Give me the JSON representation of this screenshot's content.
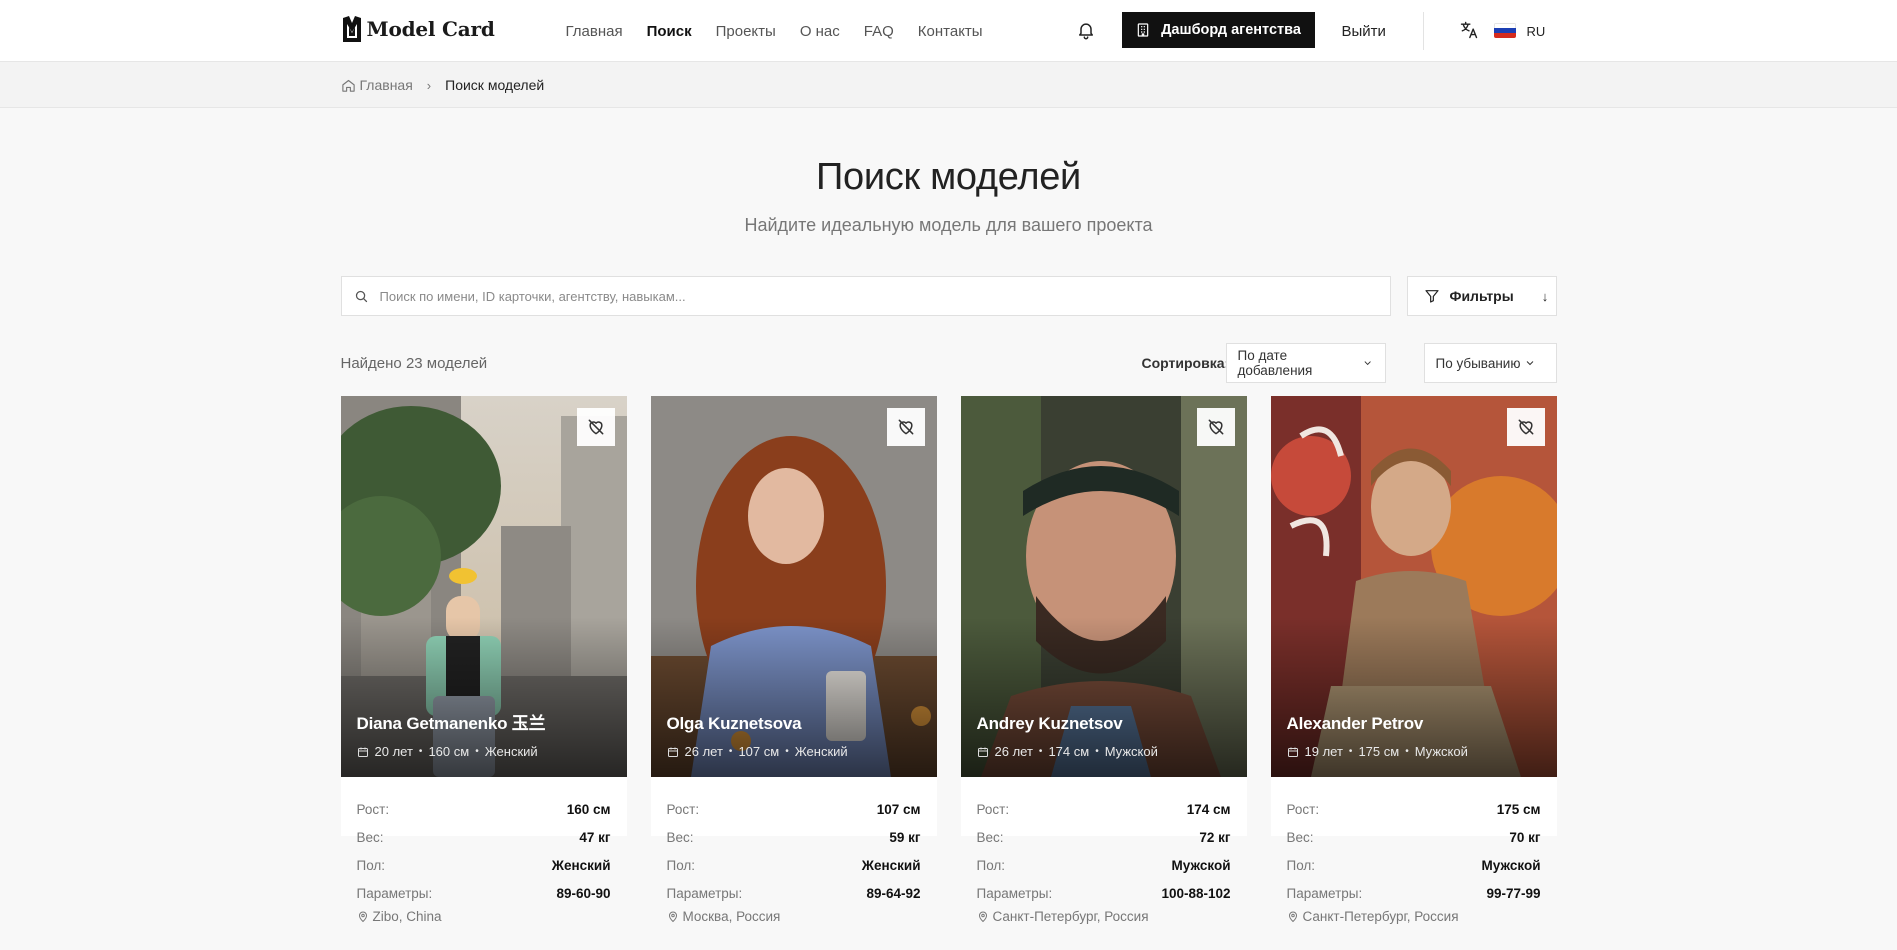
{
  "header": {
    "logo_text": "Model Card",
    "nav": [
      {
        "label": "Главная",
        "active": false
      },
      {
        "label": "Поиск",
        "active": true
      },
      {
        "label": "Проекты",
        "active": false
      },
      {
        "label": "О нас",
        "active": false
      },
      {
        "label": "FAQ",
        "active": false
      },
      {
        "label": "Контакты",
        "active": false
      }
    ],
    "dashboard_label": "Дашборд агентства",
    "logout_label": "Выйти",
    "language": "RU"
  },
  "breadcrumb": {
    "home": "Главная",
    "current": "Поиск моделей"
  },
  "hero": {
    "title": "Поиск моделей",
    "subtitle": "Найдите идеальную модель для вашего проекта"
  },
  "search": {
    "placeholder": "Поиск по имени, ID карточки, агентству, навыкам...",
    "value": "",
    "filters_label": "Фильтры",
    "filters_arrow": "↓"
  },
  "results": {
    "found": "Найдено 23 моделей",
    "sort_label": "Сортировка:",
    "sort_by": "По дате добавления",
    "sort_order": "По убыванию"
  },
  "labels": {
    "height": "Рост:",
    "weight": "Вес:",
    "gender": "Пол:",
    "params": "Параметры:"
  },
  "cards": [
    {
      "name": "Diana Getmanenko 玉兰",
      "age": "20 лет",
      "height_short": "160 см",
      "gender_short": "Женский",
      "height": "160 см",
      "weight": "47 кг",
      "gender": "Женский",
      "params": "89-60-90",
      "location": "Zibo, China"
    },
    {
      "name": "Olga Kuznetsova",
      "age": "26 лет",
      "height_short": "107 см",
      "gender_short": "Женский",
      "height": "107 см",
      "weight": "59 кг",
      "gender": "Женский",
      "params": "89-64-92",
      "location": "Москва, Россия"
    },
    {
      "name": "Andrey Kuznetsov",
      "age": "26 лет",
      "height_short": "174 см",
      "gender_short": "Мужской",
      "height": "174 см",
      "weight": "72 кг",
      "gender": "Мужской",
      "params": "100-88-102",
      "location": "Санкт-Петербург, Россия"
    },
    {
      "name": "Alexander Petrov",
      "age": "19 лет",
      "height_short": "175 см",
      "gender_short": "Мужской",
      "height": "175 см",
      "weight": "70 кг",
      "gender": "Мужской",
      "params": "99-77-99",
      "location": "Санкт-Петербург, Россия"
    }
  ],
  "colors": {
    "primary": "#111111",
    "background": "#f8f8f8",
    "muted_text": "#777777"
  }
}
